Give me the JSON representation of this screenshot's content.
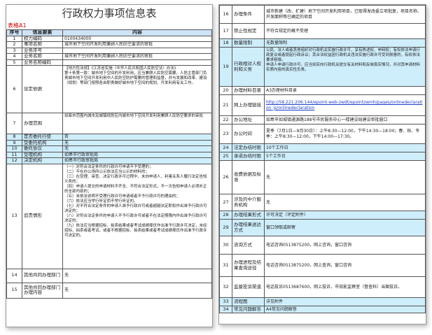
{
  "left": {
    "title": "行政权力事项信息表",
    "table_tag": "表格A1",
    "headers": [
      "序号",
      "信息要素",
      "内容"
    ],
    "rows": [
      {
        "no": "1",
        "name": "权力编码",
        "content": "0100434000"
      },
      {
        "no": "2",
        "name": "事项名称",
        "content": "城市地下空间开发利用兼顾人民防空要求的审批"
      },
      {
        "no": "3",
        "name": "业务序号",
        "content": ""
      },
      {
        "no": "4",
        "name": "业务名称",
        "content": "城市地下空间开发利用兼顾人民防空要求的审批"
      },
      {
        "no": "5",
        "name": "业务名称编码",
        "content": ""
      },
      {
        "no": "6",
        "name": "设定依据",
        "content": "【地方性法规】《江苏省实施〈中华人民共和国人民防空法〉办法》\n第十条第一款：城市地下空间的开发利用，应当兼顾人民防空需要。人防主管部门负责城市地下空间开发利用中人民防空防护需要的管理和监督，并与发展和改革、建设（规划）等部门按照各自职责做好城市地下空间的规划、开发利用有关工作。"
      },
      {
        "no": "7",
        "name": "办理范围",
        "content": "如皋市范围内城市及城镇规划区内城市地下空间开发利用兼顾人民防空要求的审批"
      },
      {
        "no": "8",
        "name": "是否委托行使",
        "content": "否"
      },
      {
        "no": "9",
        "name": "受委托机构",
        "content": "无"
      },
      {
        "no": "10",
        "name": "委托协议",
        "content": "无"
      },
      {
        "no": "11",
        "name": "受理机构",
        "content": "如皋市行政审批局"
      },
      {
        "no": "12",
        "name": "决定机构",
        "content": "如皋市行政审批局"
      },
      {
        "no": "13",
        "name": "追责情形",
        "content": "（一）对符合法定条件的行政许可申请不予受理的；\n（二）不在办公场所公示依法应当公示的材料的；\n（三）在受理、审查、决定行政许可过程中，未向申请人、利害关系人履行法定告知义务的；\n（四）申请人提交的申请材料不齐全、不符合法定形式，不一次告知申请人必须补正的全部内容的；\n（五）未依法说明不受理行政许可申请或者不予行政许可的理由的；\n（六）依法应当举行听证而不举行听证的。\n（七）对不符合法定条件的申请人准予行政许可或者超越法定职权作出准予行政许可决定的；\n（八）对符合法定条件的申请人不予行政许可或者不在法定期限内作出准予行政许可决定的；\n（九）依法应当根据招标、拍卖结果或者考试成绩择优作出准予行政许可决定，未经招标、拍卖或者考试，或者不根据招标、拍卖结果或者考试成绩择优作出准予行政许可决定的。"
      },
      {
        "no": "14",
        "name": "其他共同办理部门",
        "content": "无"
      },
      {
        "no": "15",
        "name": "其他共同办理部门办理内容",
        "content": "无"
      }
    ]
  },
  "right": {
    "rows": [
      {
        "no": "16",
        "name": "办理条件",
        "content": "城市新建（改、扩建）地下空间开发利用项目，已取得发改委立项批复，项目名称、开发面积等已确定的项目"
      },
      {
        "no": "17",
        "name": "禁止性规定",
        "content": "不符合规定的概不受理"
      },
      {
        "no": "18",
        "name": "数量限制",
        "content": "无数量限制"
      },
      {
        "no": "19",
        "name": "行政相对人权利和义务",
        "content": "公民、法人或者其他组织对行政机关实施行政许可，享有陈述权、申辩权；有权依法申请行政复议或者提起行政诉讼；其合法权益因行政机关违法实施行政许可受到损害的，有权依法要求赔偿。\n申请人申请行政许可，应当如实向行政机关提交有关材料和反映真实情况，并对其申请材料实质内容的真实性负责。"
      },
      {
        "no": "20",
        "name": "办理材料目录",
        "content": "A3办理材料目录"
      },
      {
        "no": "21",
        "name": "网上办理链接",
        "content": "http://58.221.206.144/epoint-web-zwdt/epointzwmh/pages/onlinedeclaration_js/onlinedeclaration"
      },
      {
        "no": "22",
        "name": "办公地址",
        "content": "如皋市如城镇通源路188号市民服务中心一楼建设局建设审批窗口"
      },
      {
        "no": "23",
        "name": "办公时间",
        "content": "夏季（7月1日—9月30日）：上午8:30—12:00，下午14:30—18:00；春、秋、冬季：上午8:30—12:00，下午14:00—17:30。"
      },
      {
        "no": "24",
        "name": "法定办结时限",
        "content": "10个工作日"
      },
      {
        "no": "25",
        "name": "承诺办结时限",
        "content": "5个工作日"
      },
      {
        "no": "26",
        "name": "收费依据及标准",
        "content": "无"
      },
      {
        "no": "27",
        "name": "涉及的中介服务机构",
        "content": "无"
      },
      {
        "no": "28",
        "name": "办理结果形式",
        "content": "许可决定（评定附件）"
      },
      {
        "no": "29",
        "name": "办理结果送达方式",
        "content": "窗口领取或邮寄"
      },
      {
        "no": "30",
        "name": "咨询方式",
        "content": "电话咨询0513875200，网上咨询，窗口咨询"
      },
      {
        "no": "31",
        "name": "办理进程及结果查询途径",
        "content": "电话咨询0513875200，网上查询，窗口咨询"
      },
      {
        "no": "32",
        "name": "监督投诉渠道",
        "content": "电话投诉0513687600，网上投诉，市效能监察室（督查科）当面投诉。"
      },
      {
        "no": "33",
        "name": "流程图",
        "content": "详见附件"
      },
      {
        "no": "34",
        "name": "常见问题解答",
        "content": "A4常见问题解答"
      }
    ]
  }
}
